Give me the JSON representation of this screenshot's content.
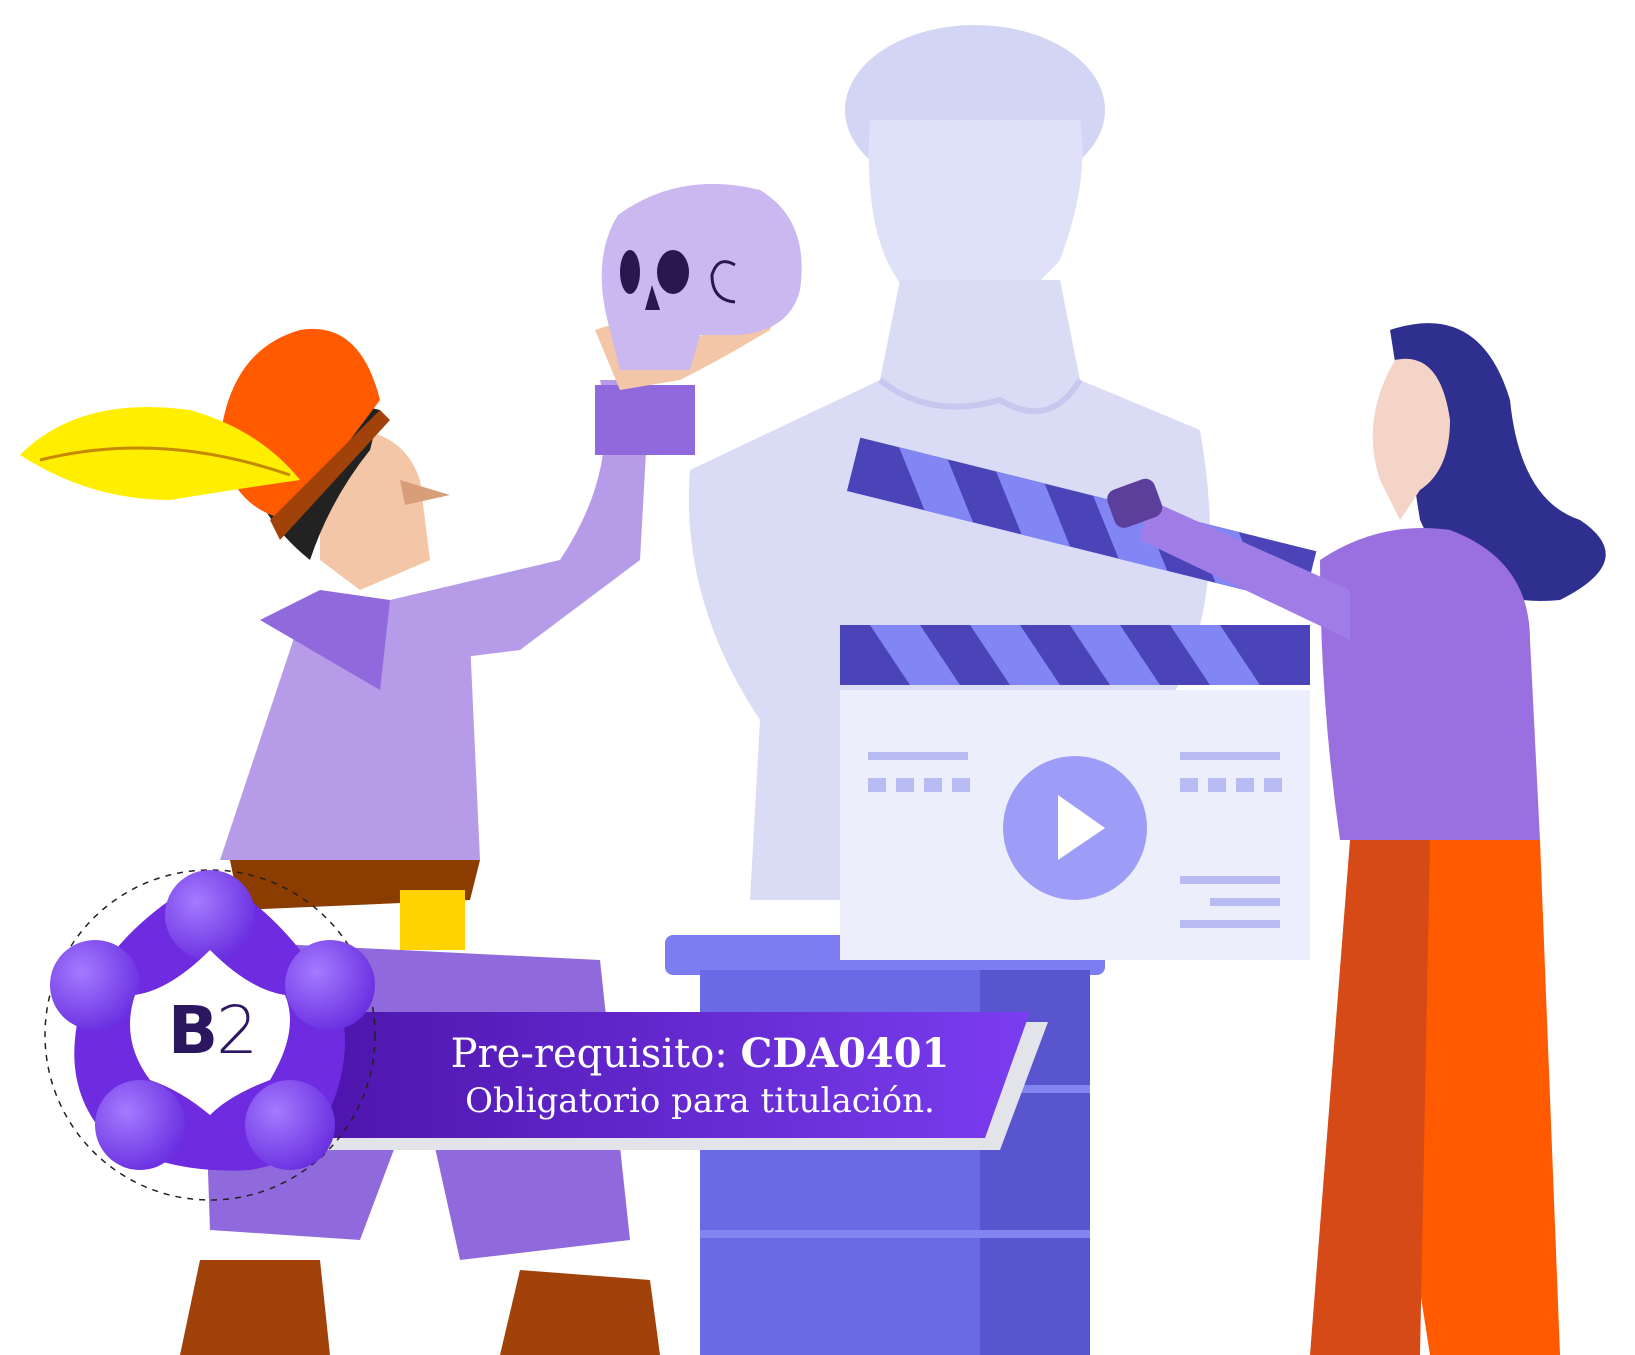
{
  "badge": {
    "level_letter": "B",
    "level_number": "2"
  },
  "banner": {
    "prerequisite_label": "Pre-requisito:",
    "prerequisite_code": "CDA0401",
    "requirement_text": "Obligatorio para titulación."
  },
  "colors": {
    "purple_main": "#6f2bdf",
    "purple_light": "#b59be8",
    "lavender": "#d7d9f6",
    "pedestal": "#6b6ae6",
    "orange": "#ff5a00",
    "navy": "#2f2f8f"
  },
  "icons": [
    "skull-icon",
    "play-icon",
    "clapperboard-icon",
    "feather-icon"
  ]
}
